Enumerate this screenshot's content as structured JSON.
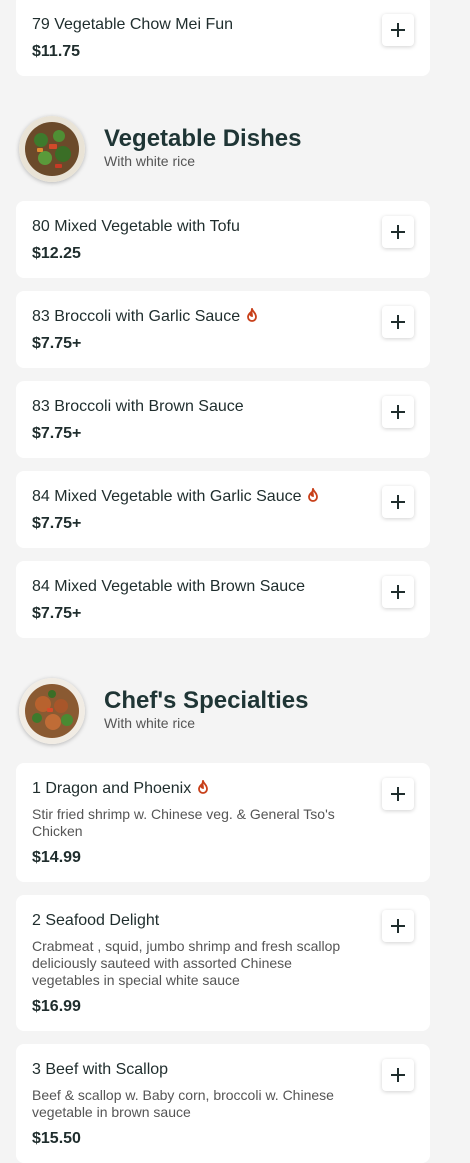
{
  "items_top": [
    {
      "name": "79 Vegetable Chow Mei Fun",
      "price": "$11.75"
    }
  ],
  "categories": [
    {
      "title": "Vegetable Dishes",
      "subtitle": "With white rice",
      "photo_icon": "stir-fry-vegetables-photo",
      "items": [
        {
          "name": "80 Mixed Vegetable with Tofu",
          "price": "$12.25",
          "spicy": false
        },
        {
          "name": "83 Broccoli with Garlic Sauce",
          "price": "$7.75+",
          "spicy": true
        },
        {
          "name": "83 Broccoli with Brown Sauce",
          "price": "$7.75+",
          "spicy": false
        },
        {
          "name": "84 Mixed Vegetable with Garlic Sauce",
          "price": "$7.75+",
          "spicy": true
        },
        {
          "name": "84 Mixed Vegetable with Brown Sauce",
          "price": "$7.75+",
          "spicy": false
        }
      ]
    },
    {
      "title": "Chef's Specialties",
      "subtitle": "With white rice",
      "photo_icon": "chicken-broccoli-photo",
      "items": [
        {
          "name": "1 Dragon and Phoenix",
          "description": "Stir fried shrimp w. Chinese veg. & General Tso's Chicken",
          "price": "$14.99",
          "spicy": true
        },
        {
          "name": "2 Seafood Delight",
          "description": "Crabmeat , squid, jumbo shrimp and fresh scallop deliciously sauteed with assorted Chinese vegetables in special white sauce",
          "price": "$16.99",
          "spicy": false
        },
        {
          "name": "3 Beef with Scallop",
          "description": "Beef & scallop w. Baby corn, broccoli w. Chinese vegetable in brown sauce",
          "price": "$15.50",
          "spicy": false
        }
      ]
    }
  ],
  "colors": {
    "background": "#f4f4f4",
    "card": "#ffffff",
    "title": "#1f3535",
    "spicy": "#c8401a"
  },
  "icons": {
    "add": "plus-icon",
    "spicy": "fire-icon"
  }
}
